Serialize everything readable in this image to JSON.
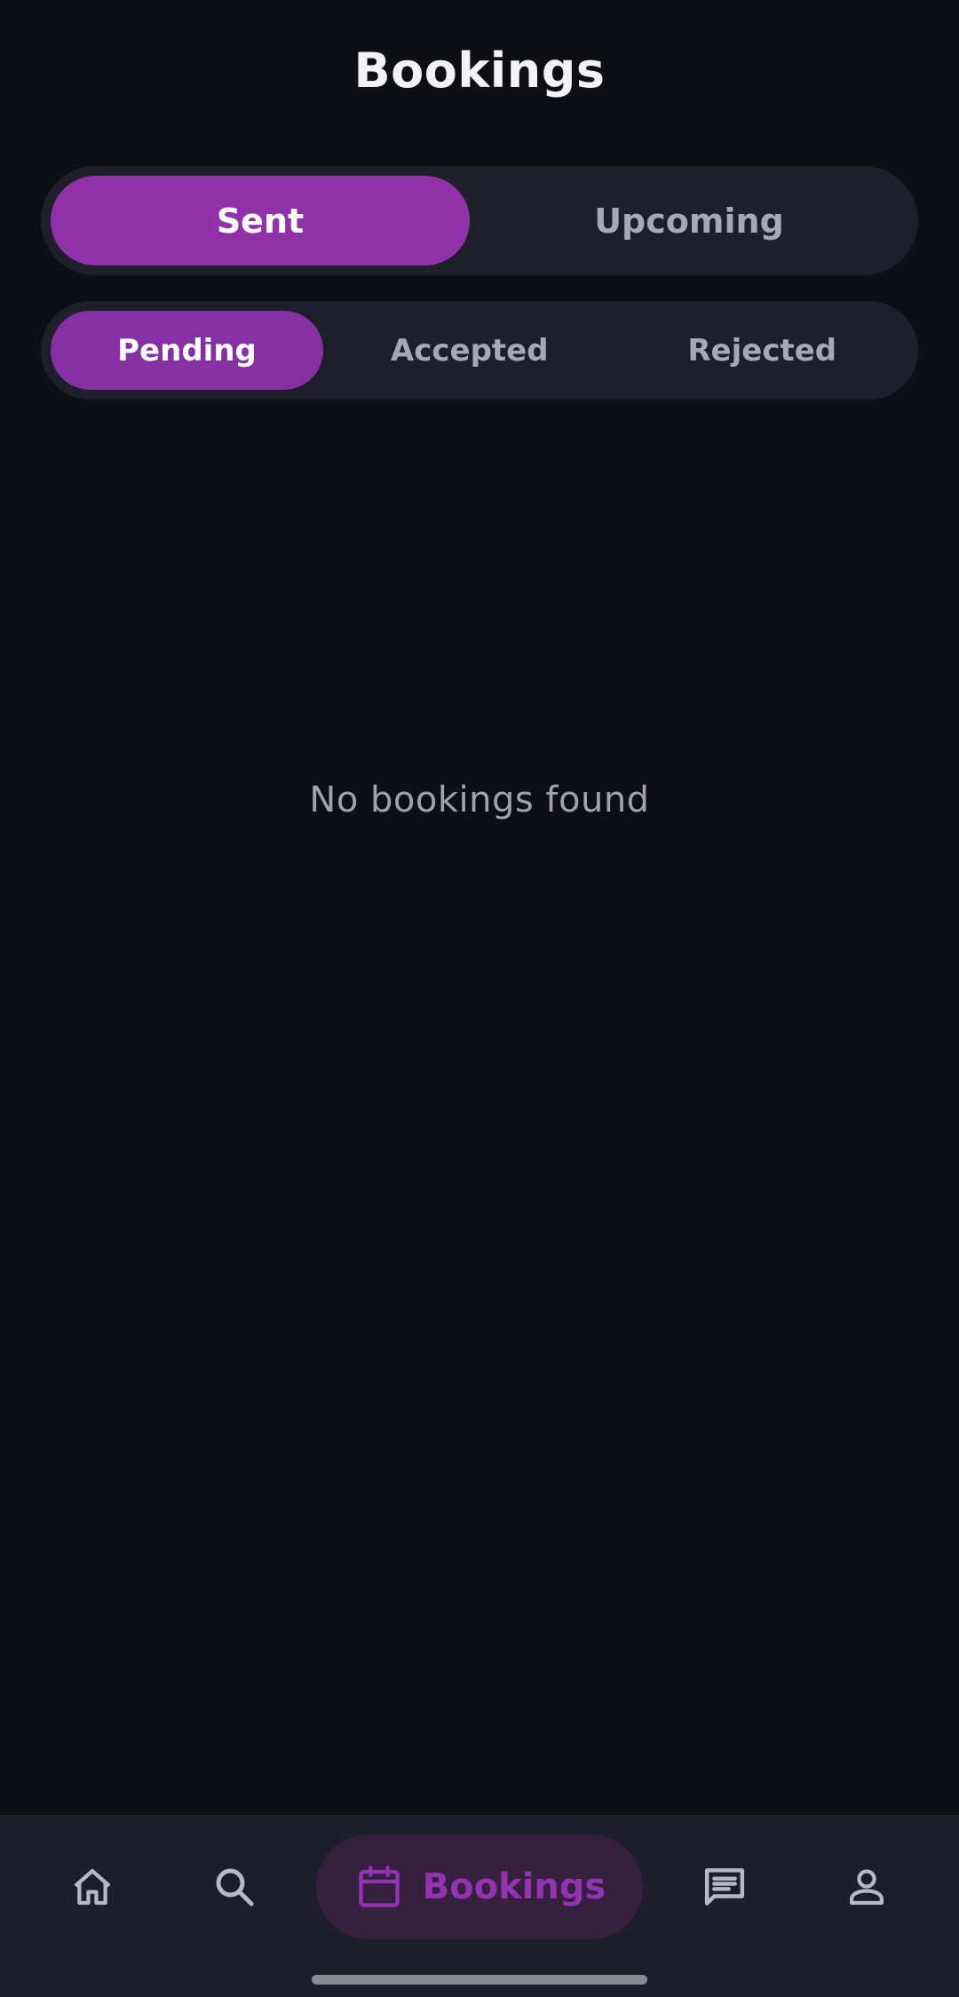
{
  "header": {
    "title": "Bookings"
  },
  "primary_tabs": [
    {
      "label": "Sent",
      "active": true
    },
    {
      "label": "Upcoming",
      "active": false
    }
  ],
  "status_tabs": [
    {
      "label": "Pending",
      "active": true
    },
    {
      "label": "Accepted",
      "active": false
    },
    {
      "label": "Rejected",
      "active": false
    }
  ],
  "content": {
    "empty_message": "No bookings found"
  },
  "bottom_nav": {
    "items": [
      {
        "icon": "home-icon",
        "label": "",
        "active": false
      },
      {
        "icon": "search-icon",
        "label": "",
        "active": false
      },
      {
        "icon": "calendar-icon",
        "label": "Bookings",
        "active": true
      },
      {
        "icon": "chat-icon",
        "label": "",
        "active": false
      },
      {
        "icon": "person-icon",
        "label": "",
        "active": false
      }
    ]
  },
  "colors": {
    "background": "#0e0f14",
    "surface": "#1e1f2b",
    "accent": "#9232ab",
    "accent_secondary": "#8530a3",
    "nav_active_bg": "#35203f",
    "text_primary": "#f3f3f6",
    "text_secondary": "#a8a8b3"
  }
}
